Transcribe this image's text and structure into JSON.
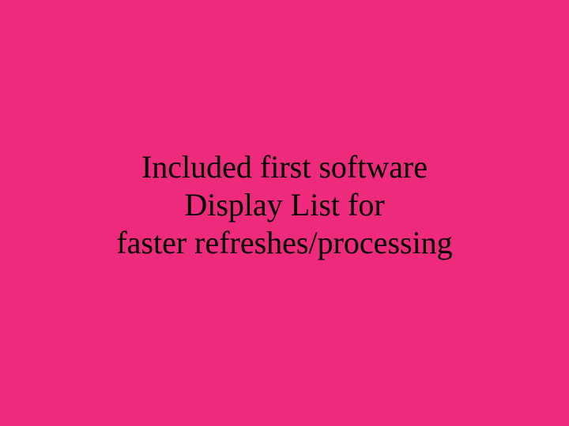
{
  "slide": {
    "line1": "Included first software",
    "line2": "Display List for",
    "line3": "faster refreshes/processing"
  }
}
